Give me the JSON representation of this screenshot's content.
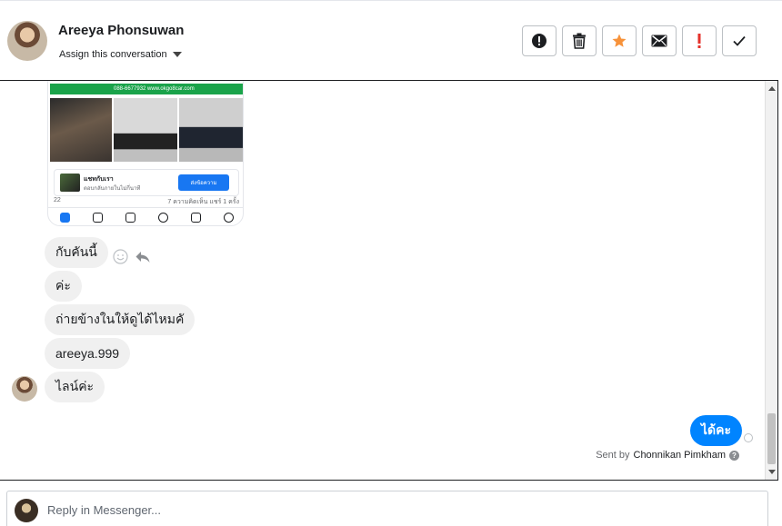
{
  "header": {
    "contact_name": "Areeya Phonsuwan",
    "assign_label": "Assign this conversation"
  },
  "actions": [
    {
      "name": "mark-spam-button",
      "icon": "exclamation-circle-icon"
    },
    {
      "name": "delete-button",
      "icon": "trash-icon"
    },
    {
      "name": "star-button",
      "icon": "star-icon",
      "color": "#f7923a"
    },
    {
      "name": "mark-unread-button",
      "icon": "envelope-icon"
    },
    {
      "name": "follow-up-button",
      "icon": "exclamation-icon",
      "color": "#e4322b"
    },
    {
      "name": "mark-done-button",
      "icon": "checkmark-icon"
    }
  ],
  "shared_image": {
    "banner_text": "088-6677932 www.okgo8car.com",
    "card_title": "แชทกับเรา",
    "card_subtitle": "ตอบกลับภายในไม่กี่นาที",
    "card_button": "ส่งข้อความ",
    "likes": "22",
    "stats": "7 ความคิดเห็น  แชร์ 1 ครั้ง"
  },
  "messages": [
    {
      "text": "กับคันนี้"
    },
    {
      "text": "ค่ะ"
    },
    {
      "text": "ถ่ายข้างในให้ดูได้ไหมคั"
    },
    {
      "text": "areeya.999"
    },
    {
      "text": "ไลน์ค่ะ"
    }
  ],
  "sent_message": {
    "text": "ได้คะ",
    "sent_by_prefix": "Sent by",
    "sent_by_name": "Chonnikan Pimkham"
  },
  "reply": {
    "placeholder": "Reply in Messenger..."
  },
  "colors": {
    "accent": "#0084ff",
    "star": "#f7923a",
    "flag": "#e4322b",
    "bubble": "#f0f0f0"
  }
}
